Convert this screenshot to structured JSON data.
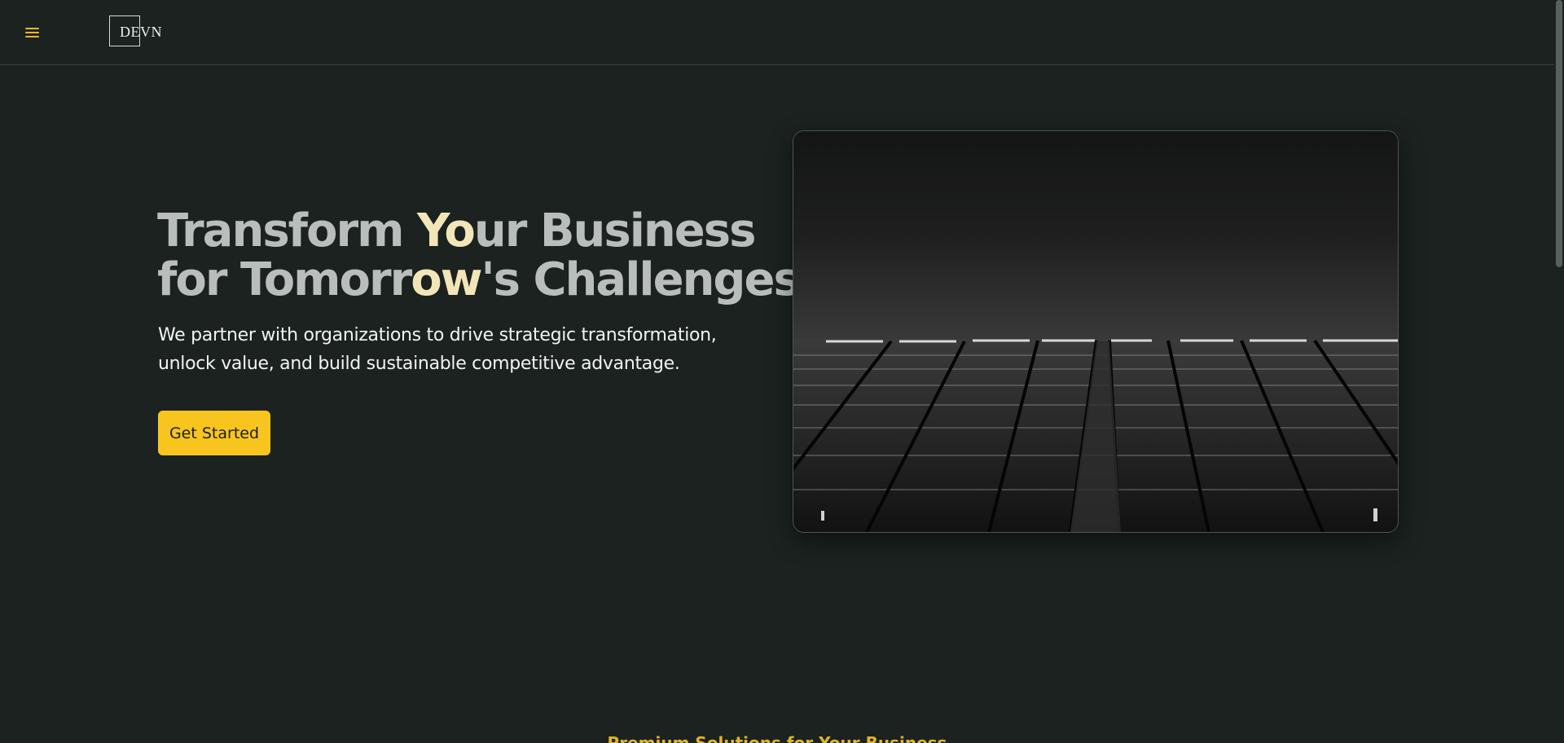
{
  "header": {
    "logo_text": "DEVN"
  },
  "hero": {
    "title_line1_a": "Transform ",
    "title_line1_hl": "Yo",
    "title_line1_b": "ur Business",
    "title_line2_a": "for Tomorr",
    "title_line2_hl": "ow",
    "title_line2_b": "'s Challenges",
    "subtitle": "We partner with organizations to drive strategic transformation, unlock value, and build sustainable competitive advantage.",
    "cta_label": "Get Started"
  },
  "section": {
    "title": "Premium Solutions for Your Business"
  },
  "colors": {
    "background": "#1b2220",
    "accent": "#f7c51d",
    "title": "#b9bdbb",
    "title_highlight": "#f2e6b8"
  },
  "icons": {
    "menu": "hamburger-icon"
  }
}
